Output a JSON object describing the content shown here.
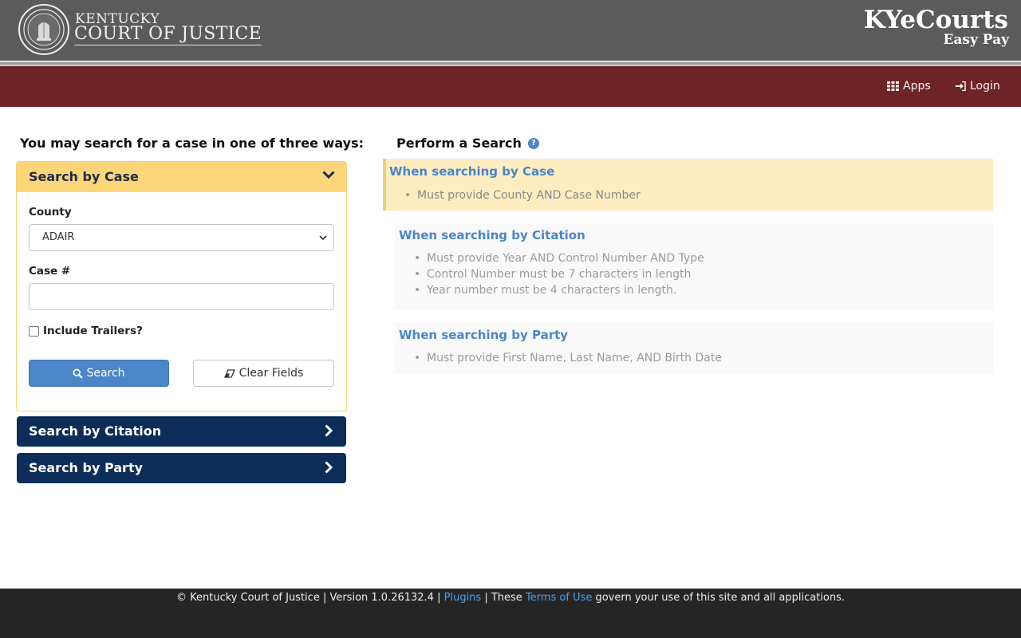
{
  "header": {
    "brand_line1": "KENTUCKY",
    "brand_line2": "COURT OF JUSTICE",
    "app_title": "KYeCourts",
    "app_subtitle": "Easy Pay"
  },
  "nav": {
    "apps_label": "Apps",
    "login_label": "Login"
  },
  "left": {
    "heading": "You may search for a case in one of three ways:",
    "case_panel": {
      "title": "Search by Case",
      "county_label": "County",
      "county_value": "ADAIR",
      "case_label": "Case #",
      "case_value": "",
      "include_trailers_label": "Include Trailers?",
      "search_button": "Search",
      "clear_button": "Clear Fields"
    },
    "citation_panel_title": "Search by Citation",
    "party_panel_title": "Search by Party"
  },
  "right": {
    "heading": "Perform a Search",
    "case_info": {
      "title": "When searching by Case",
      "items": [
        "Must provide County AND Case Number"
      ]
    },
    "citation_info": {
      "title": "When searching by Citation",
      "items": [
        "Must provide Year AND Control Number AND Type",
        "Control Number must be 7 characters in length",
        "Year number must be 4 characters in length."
      ]
    },
    "party_info": {
      "title": "When searching by Party",
      "items": [
        "Must provide First Name, Last Name, AND Birth Date"
      ]
    }
  },
  "footer": {
    "copyright": "© Kentucky Court of Justice | Version 1.0.26132.4 |",
    "plugins_link": "Plugins",
    "sep": "| These",
    "terms_link": "Terms of Use",
    "tail": "govern your use of this site and all applications."
  },
  "colors": {
    "header_bg": "#5b5b5b",
    "navbar_bg": "#6e2326",
    "accordion_open": "#fcd678",
    "accordion_closed": "#0c2d57",
    "primary_button": "#4a86c8",
    "link": "#4aa3e8"
  }
}
